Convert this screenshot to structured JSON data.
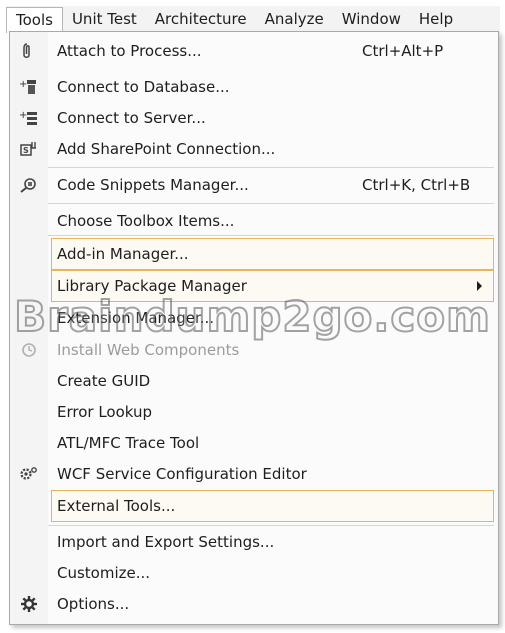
{
  "menubar": {
    "items": [
      "Tools",
      "Unit Test",
      "Architecture",
      "Analyze",
      "Window",
      "Help"
    ]
  },
  "menu": {
    "items": [
      {
        "label": "Attach to Process...",
        "shortcut": "Ctrl+Alt+P",
        "icon": "attach-icon"
      },
      {
        "label": "Connect to Database...",
        "icon": "database-connect-icon"
      },
      {
        "label": "Connect to Server...",
        "icon": "server-connect-icon"
      },
      {
        "label": "Add SharePoint Connection...",
        "icon": "sharepoint-icon"
      },
      {
        "label": "Code Snippets Manager...",
        "shortcut": "Ctrl+K, Ctrl+B",
        "icon": "snippets-icon"
      },
      {
        "label": "Choose Toolbox Items..."
      },
      {
        "label": "Add-in Manager...",
        "highlighted": true
      },
      {
        "label": "Library Package Manager",
        "submenu": true,
        "highlighted": true
      },
      {
        "label": "Extension Manager..."
      },
      {
        "label": "Install Web Components",
        "disabled": true,
        "icon": "install-icon"
      },
      {
        "label": "Create GUID"
      },
      {
        "label": "Error Lookup"
      },
      {
        "label": "ATL/MFC Trace Tool"
      },
      {
        "label": "WCF Service Configuration Editor",
        "icon": "wcf-config-icon"
      },
      {
        "label": "External Tools...",
        "highlighted": true
      },
      {
        "label": "Import and Export Settings..."
      },
      {
        "label": "Customize..."
      },
      {
        "label": "Options...",
        "icon": "gear-icon"
      }
    ]
  },
  "watermark": "Braindump2go.com"
}
